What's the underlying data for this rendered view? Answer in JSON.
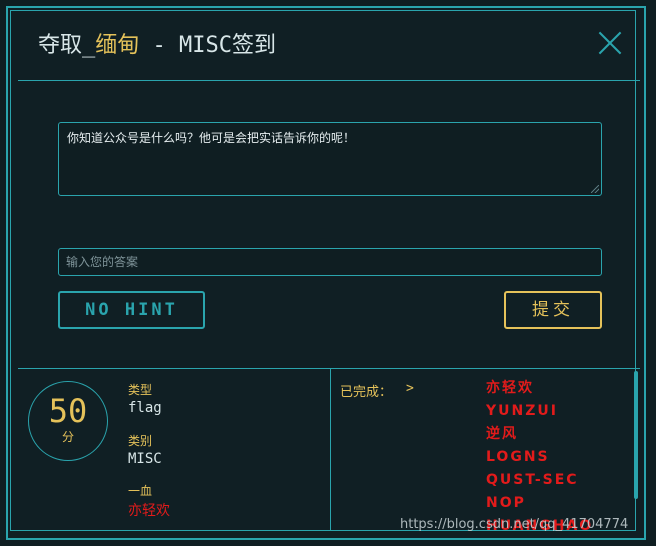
{
  "header": {
    "title_prefix": "夺取_",
    "title_highlight": "缅甸",
    "title_suffix": " - MISC签到"
  },
  "question": {
    "text": "你知道公众号是什么吗？他可是会把实话告诉你的呢！"
  },
  "answer": {
    "placeholder": "输入您的答案",
    "value": ""
  },
  "buttons": {
    "hint_label": "NO HINT",
    "submit_label": "提交"
  },
  "score": {
    "points": "50",
    "unit": "分"
  },
  "meta": {
    "type_label": "类型",
    "type_value": "flag",
    "category_label": "类别",
    "category_value": "MISC",
    "first_blood_label": "一血",
    "first_blood_value": "亦轻欢"
  },
  "completed": {
    "label": "已完成：",
    "arrow": ">",
    "solvers": [
      "亦轻欢",
      "YUNZUI",
      "逆风",
      "LOGNS",
      "QUST-SEC",
      "NOP",
      "HUANGHAO"
    ]
  },
  "watermark": "https://blog.csdn.net/qq_41704774",
  "colors": {
    "accent": "#2aa4ad",
    "gold": "#e5c25a",
    "red": "#e21b1b",
    "background": "#101f24"
  }
}
